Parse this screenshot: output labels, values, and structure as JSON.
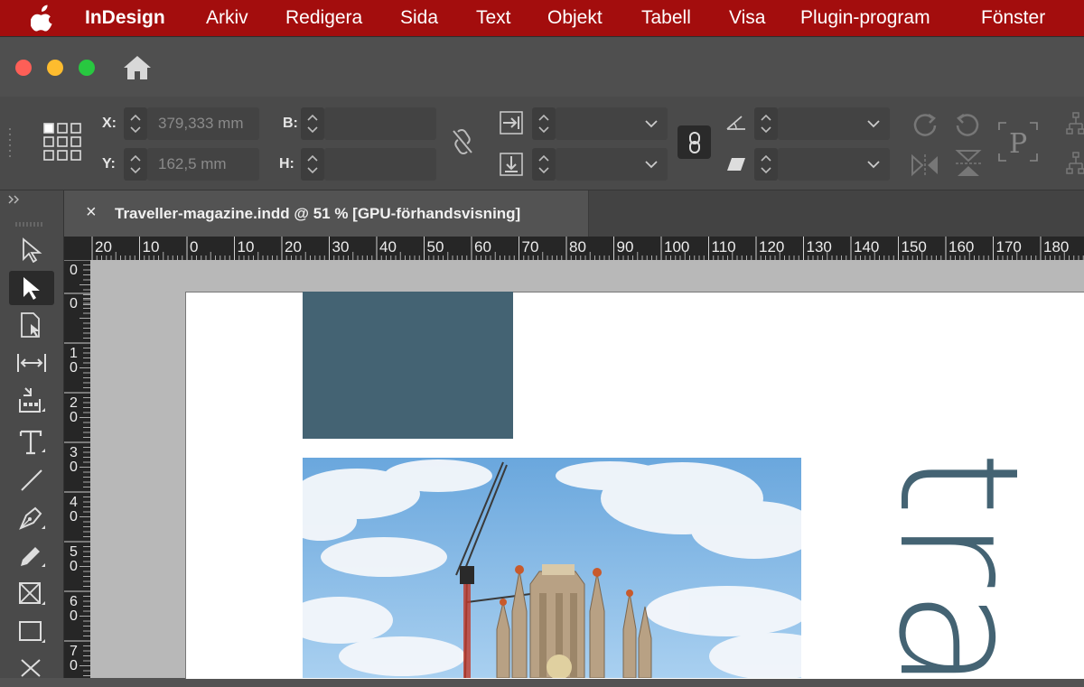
{
  "menubar": {
    "app_name": "InDesign",
    "items": [
      "Arkiv",
      "Redigera",
      "Sida",
      "Text",
      "Objekt",
      "Tabell",
      "Visa",
      "Plugin-program",
      "Fönster"
    ]
  },
  "control": {
    "x_label": "X:",
    "x_value": "379,333 mm",
    "y_label": "Y:",
    "y_value": "162,5 mm",
    "w_label": "B:",
    "h_label": "H:",
    "placeholder_letter": "P"
  },
  "document": {
    "tab_title": "Traveller-magazine.indd @ 51 % [GPU-förhandsvisning]",
    "close_glyph": "×",
    "headline_text": "tra"
  },
  "rulers": {
    "horizontal": [
      "20",
      "10",
      "0",
      "10",
      "20",
      "30",
      "40",
      "50",
      "60",
      "70",
      "80",
      "90",
      "100",
      "110",
      "120",
      "130",
      "140",
      "150",
      "160",
      "170",
      "180"
    ],
    "vertical": [
      "0",
      "0",
      "1\n0",
      "2\n0",
      "3\n0",
      "4\n0",
      "5\n0",
      "6\n0",
      "7\n0"
    ]
  },
  "colors": {
    "menubar": "#a30d0d",
    "blue_frame": "#446373",
    "headline": "#446373",
    "sky": "#7fb7e6"
  },
  "icons": [
    "apple-icon",
    "home-icon",
    "reference-point-icon",
    "link-icon",
    "rotate-icon",
    "shear-icon",
    "flip-icon",
    "selection-tool-icon",
    "direct-selection-tool-icon",
    "page-tool-icon",
    "gap-tool-icon",
    "content-collector-icon",
    "type-tool-icon",
    "line-tool-icon",
    "pen-tool-icon",
    "pencil-tool-icon",
    "rectangle-frame-tool-icon",
    "rectangle-tool-icon",
    "scissors-tool-icon"
  ]
}
